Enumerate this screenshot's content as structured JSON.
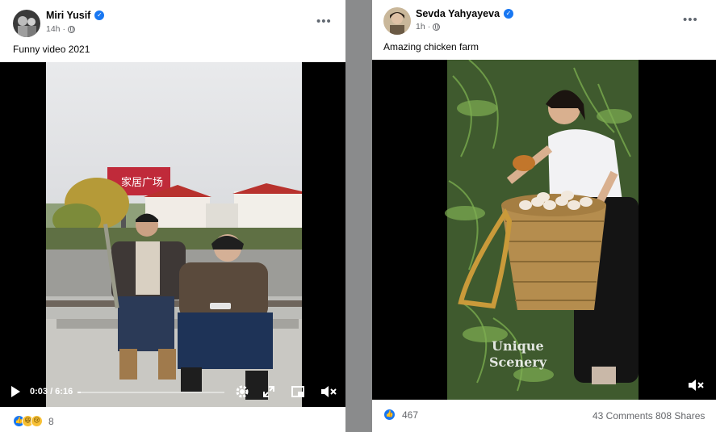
{
  "left_post": {
    "author": "Miri Yusif",
    "time": "14h",
    "caption": "Funny video 2021",
    "video": {
      "time_display": "0:03 / 6:16",
      "progress": 0.008,
      "sign_text": "家居广场"
    },
    "reactions": {
      "count": "8",
      "icons": [
        "like-icon",
        "haha-icon",
        "sad-icon"
      ]
    }
  },
  "right_post": {
    "author": "Sevda Yahyayeva",
    "time": "1h",
    "caption": "Amazing chicken farm",
    "video": {
      "watermark_line1": "Unique",
      "watermark_line2": "Scenery"
    },
    "reactions": {
      "count": "467",
      "comments": "43 Comments",
      "shares": "808 Shares"
    }
  },
  "colors": {
    "accent": "#1877f2",
    "background": "#8a8b8c",
    "card": "#ffffff",
    "secondary_text": "#65676b"
  }
}
